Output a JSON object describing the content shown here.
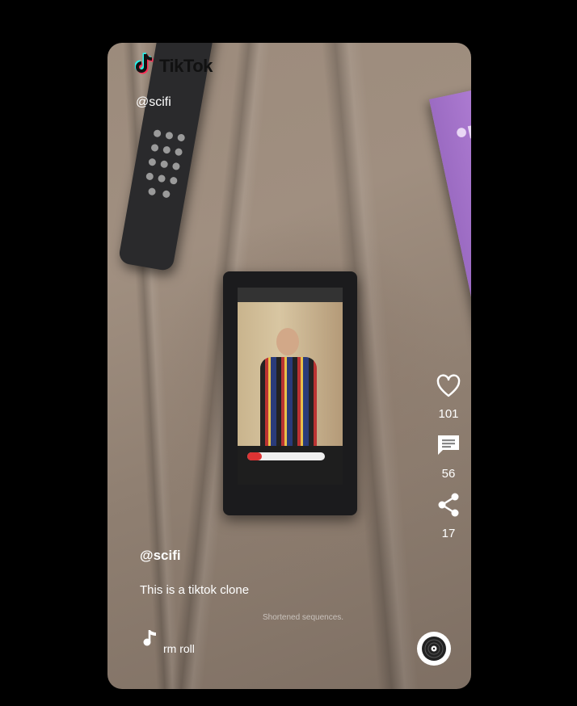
{
  "brand": {
    "name": "TikTok"
  },
  "header": {
    "username": "@scifi"
  },
  "video": {
    "subtitle": "Shortened sequences."
  },
  "actions": {
    "likes": "101",
    "comments": "56",
    "shares": "17"
  },
  "post": {
    "username": "@scifi",
    "description": "This is a tiktok clone",
    "song": "rm roll"
  },
  "background_art": {
    "magazine_text": "i m"
  },
  "icons": [
    "tiktok-logo-icon",
    "heart-icon",
    "comment-icon",
    "share-icon",
    "music-note-icon",
    "disc-icon"
  ],
  "colors": {
    "page_bg": "#000000",
    "text": "#ffffff",
    "logo_cyan": "#25f4ee",
    "logo_red": "#fe2c55"
  }
}
